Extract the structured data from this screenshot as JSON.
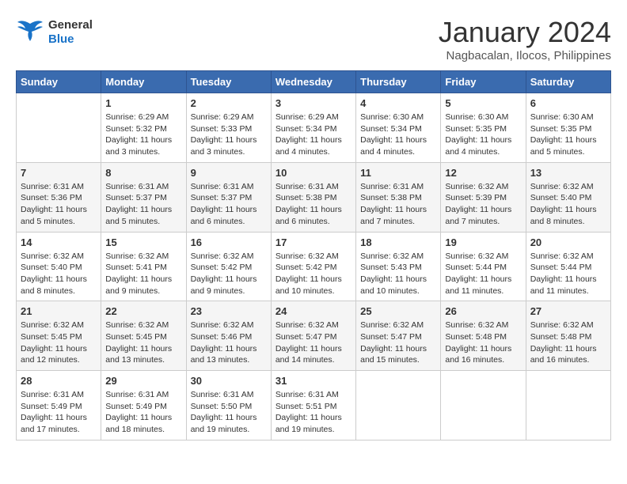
{
  "header": {
    "logo_line1": "General",
    "logo_line2": "Blue",
    "month_title": "January 2024",
    "subtitle": "Nagbacalan, Ilocos, Philippines"
  },
  "weekdays": [
    "Sunday",
    "Monday",
    "Tuesday",
    "Wednesday",
    "Thursday",
    "Friday",
    "Saturday"
  ],
  "weeks": [
    [
      {
        "day": "",
        "info": ""
      },
      {
        "day": "1",
        "info": "Sunrise: 6:29 AM\nSunset: 5:32 PM\nDaylight: 11 hours\nand 3 minutes."
      },
      {
        "day": "2",
        "info": "Sunrise: 6:29 AM\nSunset: 5:33 PM\nDaylight: 11 hours\nand 3 minutes."
      },
      {
        "day": "3",
        "info": "Sunrise: 6:29 AM\nSunset: 5:34 PM\nDaylight: 11 hours\nand 4 minutes."
      },
      {
        "day": "4",
        "info": "Sunrise: 6:30 AM\nSunset: 5:34 PM\nDaylight: 11 hours\nand 4 minutes."
      },
      {
        "day": "5",
        "info": "Sunrise: 6:30 AM\nSunset: 5:35 PM\nDaylight: 11 hours\nand 4 minutes."
      },
      {
        "day": "6",
        "info": "Sunrise: 6:30 AM\nSunset: 5:35 PM\nDaylight: 11 hours\nand 5 minutes."
      }
    ],
    [
      {
        "day": "7",
        "info": "Sunrise: 6:31 AM\nSunset: 5:36 PM\nDaylight: 11 hours\nand 5 minutes."
      },
      {
        "day": "8",
        "info": "Sunrise: 6:31 AM\nSunset: 5:37 PM\nDaylight: 11 hours\nand 5 minutes."
      },
      {
        "day": "9",
        "info": "Sunrise: 6:31 AM\nSunset: 5:37 PM\nDaylight: 11 hours\nand 6 minutes."
      },
      {
        "day": "10",
        "info": "Sunrise: 6:31 AM\nSunset: 5:38 PM\nDaylight: 11 hours\nand 6 minutes."
      },
      {
        "day": "11",
        "info": "Sunrise: 6:31 AM\nSunset: 5:38 PM\nDaylight: 11 hours\nand 7 minutes."
      },
      {
        "day": "12",
        "info": "Sunrise: 6:32 AM\nSunset: 5:39 PM\nDaylight: 11 hours\nand 7 minutes."
      },
      {
        "day": "13",
        "info": "Sunrise: 6:32 AM\nSunset: 5:40 PM\nDaylight: 11 hours\nand 8 minutes."
      }
    ],
    [
      {
        "day": "14",
        "info": "Sunrise: 6:32 AM\nSunset: 5:40 PM\nDaylight: 11 hours\nand 8 minutes."
      },
      {
        "day": "15",
        "info": "Sunrise: 6:32 AM\nSunset: 5:41 PM\nDaylight: 11 hours\nand 9 minutes."
      },
      {
        "day": "16",
        "info": "Sunrise: 6:32 AM\nSunset: 5:42 PM\nDaylight: 11 hours\nand 9 minutes."
      },
      {
        "day": "17",
        "info": "Sunrise: 6:32 AM\nSunset: 5:42 PM\nDaylight: 11 hours\nand 10 minutes."
      },
      {
        "day": "18",
        "info": "Sunrise: 6:32 AM\nSunset: 5:43 PM\nDaylight: 11 hours\nand 10 minutes."
      },
      {
        "day": "19",
        "info": "Sunrise: 6:32 AM\nSunset: 5:44 PM\nDaylight: 11 hours\nand 11 minutes."
      },
      {
        "day": "20",
        "info": "Sunrise: 6:32 AM\nSunset: 5:44 PM\nDaylight: 11 hours\nand 11 minutes."
      }
    ],
    [
      {
        "day": "21",
        "info": "Sunrise: 6:32 AM\nSunset: 5:45 PM\nDaylight: 11 hours\nand 12 minutes."
      },
      {
        "day": "22",
        "info": "Sunrise: 6:32 AM\nSunset: 5:45 PM\nDaylight: 11 hours\nand 13 minutes."
      },
      {
        "day": "23",
        "info": "Sunrise: 6:32 AM\nSunset: 5:46 PM\nDaylight: 11 hours\nand 13 minutes."
      },
      {
        "day": "24",
        "info": "Sunrise: 6:32 AM\nSunset: 5:47 PM\nDaylight: 11 hours\nand 14 minutes."
      },
      {
        "day": "25",
        "info": "Sunrise: 6:32 AM\nSunset: 5:47 PM\nDaylight: 11 hours\nand 15 minutes."
      },
      {
        "day": "26",
        "info": "Sunrise: 6:32 AM\nSunset: 5:48 PM\nDaylight: 11 hours\nand 16 minutes."
      },
      {
        "day": "27",
        "info": "Sunrise: 6:32 AM\nSunset: 5:48 PM\nDaylight: 11 hours\nand 16 minutes."
      }
    ],
    [
      {
        "day": "28",
        "info": "Sunrise: 6:31 AM\nSunset: 5:49 PM\nDaylight: 11 hours\nand 17 minutes."
      },
      {
        "day": "29",
        "info": "Sunrise: 6:31 AM\nSunset: 5:49 PM\nDaylight: 11 hours\nand 18 minutes."
      },
      {
        "day": "30",
        "info": "Sunrise: 6:31 AM\nSunset: 5:50 PM\nDaylight: 11 hours\nand 19 minutes."
      },
      {
        "day": "31",
        "info": "Sunrise: 6:31 AM\nSunset: 5:51 PM\nDaylight: 11 hours\nand 19 minutes."
      },
      {
        "day": "",
        "info": ""
      },
      {
        "day": "",
        "info": ""
      },
      {
        "day": "",
        "info": ""
      }
    ]
  ]
}
